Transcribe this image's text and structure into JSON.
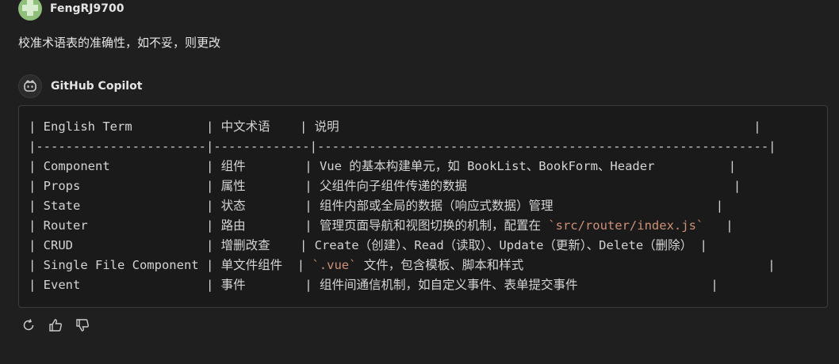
{
  "user": {
    "name": "FengRJ9700",
    "message": "校准术语表的准确性，如不妥，则更改"
  },
  "assistant": {
    "name": "GitHub Copilot"
  },
  "code_lines": [
    "| English Term          | 中文术语    | 说明                                                        |",
    "|-----------------------|-------------|-------------------------------------------------------------|",
    "| Component             | 组件        | Vue 的基本构建单元，如 BookList、BookForm、Header          |",
    "| Props                 | 属性        | 父组件向子组件传递的数据                                    |",
    "| State                 | 状态        | 组件内部或全局的数据（响应式数据）管理                      |",
    "| Router                | 路由        | 管理页面导航和视图切换的机制，配置在 ",
    "| CRUD                  | 增删改查    | Create（创建）、Read（读取）、Update（更新）、Delete（删除） |",
    "| Single File Component | 单文件组件  | ",
    "| Event                 | 事件        | 组件间通信机制，如自定义事件、表单提交事件                  |"
  ],
  "code_highlights": {
    "router_path": "`src/router/index.js`",
    "router_tail": "   |",
    "vue_ext": "`.vue`",
    "vue_tail": " 文件，包含模板、脚本和样式                                 |"
  },
  "actions": [
    {
      "name": "retry-icon"
    },
    {
      "name": "thumbs-up-icon"
    },
    {
      "name": "thumbs-down-icon"
    }
  ]
}
